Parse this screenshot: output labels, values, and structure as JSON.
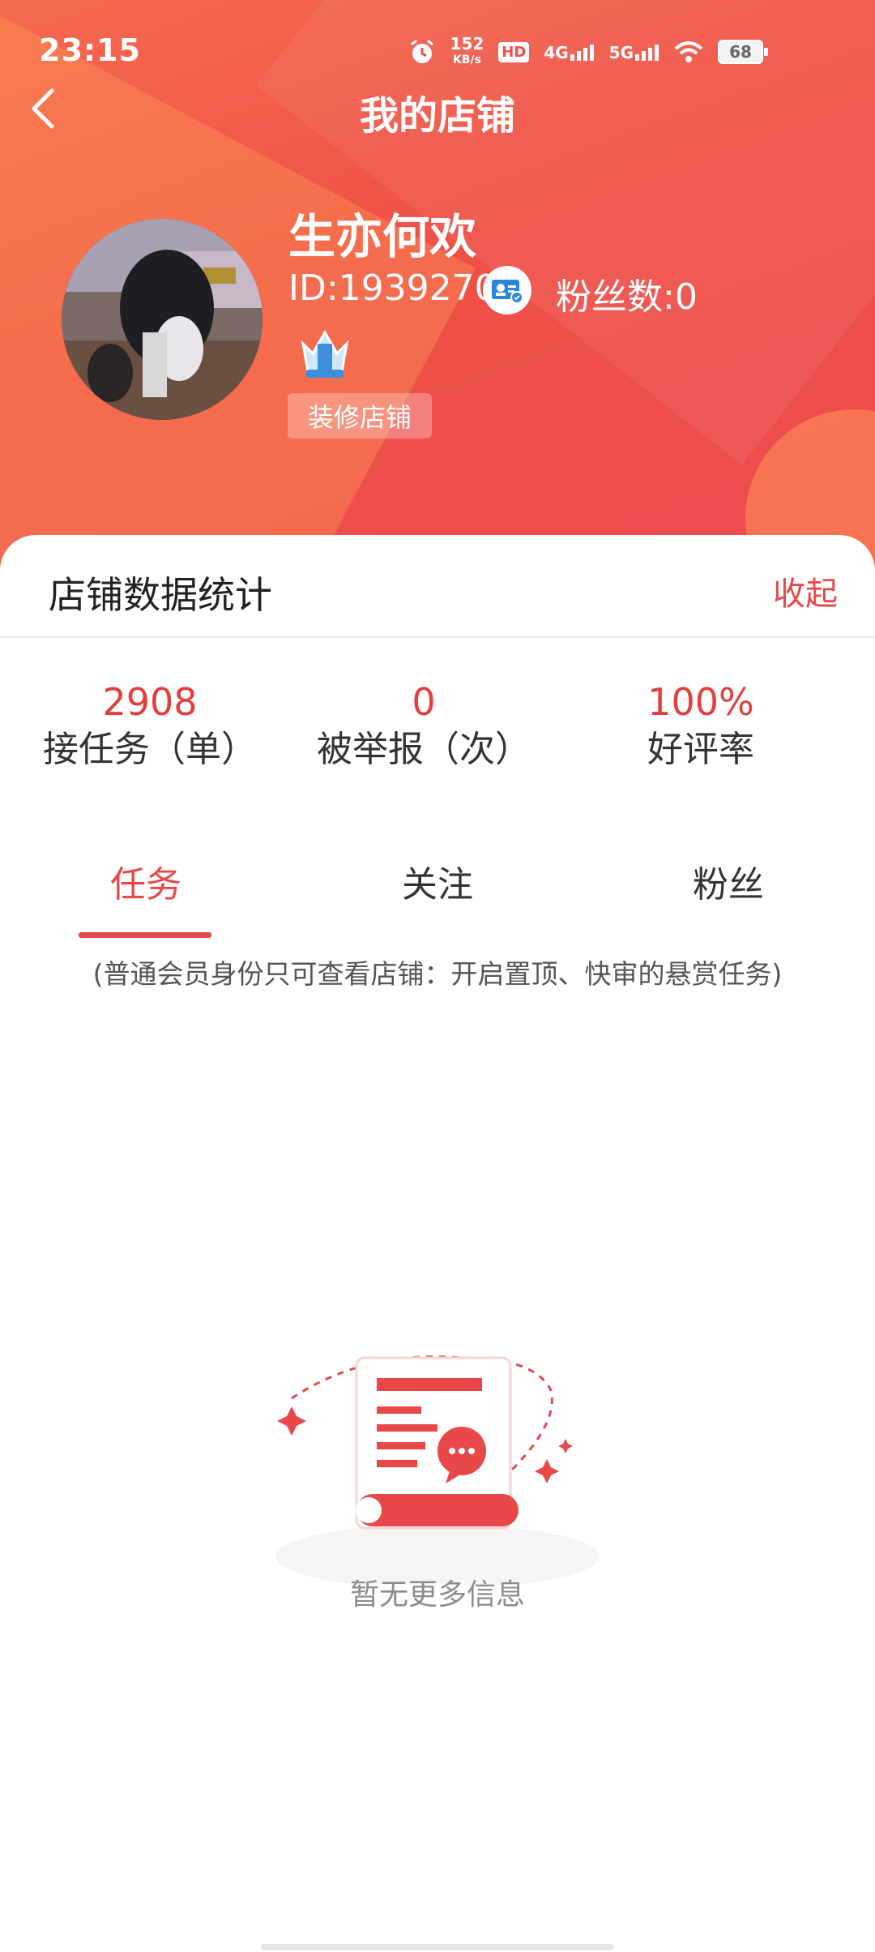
{
  "status_bar": {
    "time": "23:15",
    "net_speed_value": "152",
    "net_speed_unit": "KB/s",
    "hd_label": "HD",
    "sim1": "4G",
    "sim2": "5G",
    "battery": "68"
  },
  "header": {
    "title": "我的店铺"
  },
  "profile": {
    "name": "生亦何欢",
    "id_text": "ID:1939270",
    "fans_text": "粉丝数:0",
    "decorate_label": "装修店铺"
  },
  "stats": {
    "title": "店铺数据统计",
    "collapse_label": "收起",
    "items": [
      {
        "value": "2908",
        "label": "接任务（单）"
      },
      {
        "value": "0",
        "label": "被举报（次）"
      },
      {
        "value": "100%",
        "label": "好评率"
      }
    ]
  },
  "tabs": [
    {
      "label": "任务",
      "active": true
    },
    {
      "label": "关注",
      "active": false
    },
    {
      "label": "粉丝",
      "active": false
    }
  ],
  "notice": "(普通会员身份只可查看店铺：开启置顶、快审的悬赏任务)",
  "empty_state": {
    "text": "暂无更多信息"
  },
  "colors": {
    "accent": "#e84848",
    "header_gradient_start": "#f46a4e",
    "header_gradient_end": "#ec4c4f"
  },
  "icons": {
    "back": "chevron-left-icon",
    "id_card": "id-card-verified-icon",
    "vip": "crown-badge-icon"
  }
}
